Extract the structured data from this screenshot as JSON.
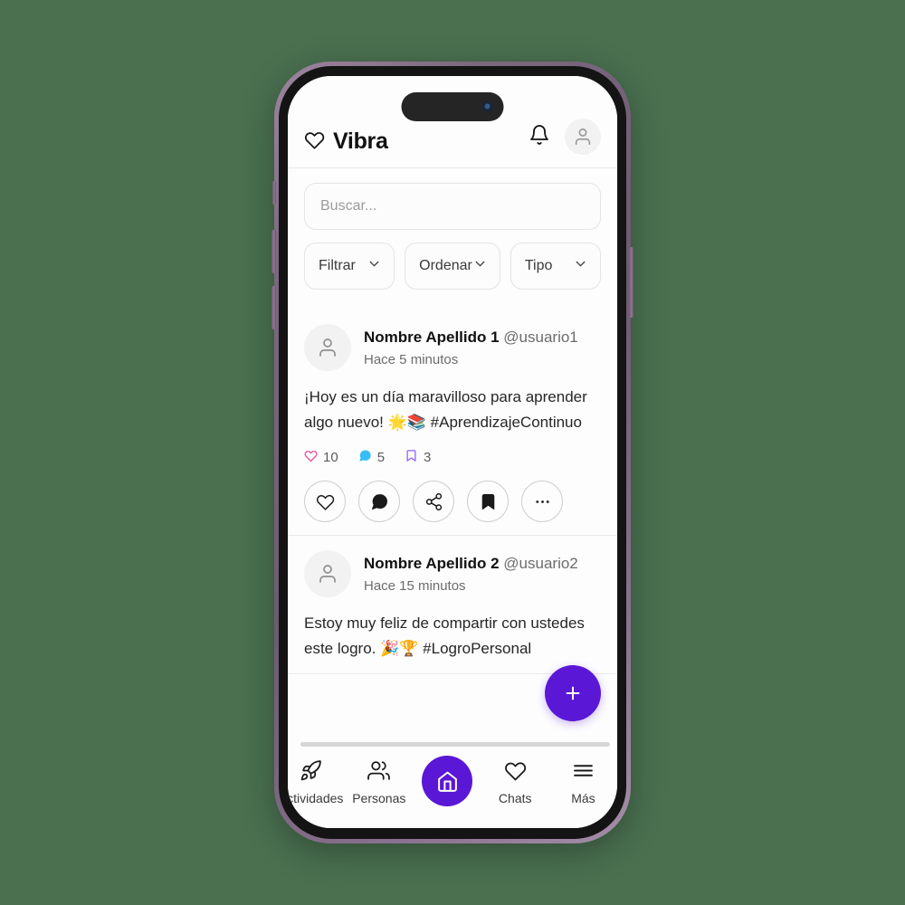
{
  "app": {
    "brand_name": "Vibra",
    "brand_icon": "heart-outline-icon",
    "notifications_icon": "bell-icon",
    "profile_icon": "user-avatar-icon"
  },
  "search": {
    "placeholder": "Buscar...",
    "value": ""
  },
  "filters": [
    {
      "label": "Filtrar",
      "icon": "chevron-down-icon"
    },
    {
      "label": "Ordenar",
      "icon": "chevron-down-icon"
    },
    {
      "label": "Tipo",
      "icon": "chevron-down-icon"
    }
  ],
  "posts": [
    {
      "author": "Nombre Apellido 1",
      "handle": "@usuario1",
      "time": "Hace 5 minutos",
      "body": "¡Hoy es un día maravilloso para aprender algo nuevo! 🌟📚 #AprendizajeContinuo",
      "stats": {
        "likes": "10",
        "comments": "5",
        "bookmarks": "3"
      }
    },
    {
      "author": "Nombre Apellido 2",
      "handle": "@usuario2",
      "time": "Hace 15 minutos",
      "body": "Estoy muy feliz de compartir con ustedes este logro. 🎉🏆 #LogroPersonal",
      "stats": {
        "likes": "",
        "comments": "",
        "bookmarks": ""
      }
    }
  ],
  "post_actions": [
    {
      "name": "like",
      "icon": "heart-icon"
    },
    {
      "name": "comment",
      "icon": "comment-icon"
    },
    {
      "name": "share",
      "icon": "share-icon"
    },
    {
      "name": "bookmark",
      "icon": "bookmark-icon"
    },
    {
      "name": "more",
      "icon": "ellipsis-icon"
    }
  ],
  "fab": {
    "label": "+",
    "icon": "plus-icon"
  },
  "bottom_nav": [
    {
      "label": "Actividades",
      "icon": "rocket-icon",
      "active": false
    },
    {
      "label": "Personas",
      "icon": "people-icon",
      "active": false
    },
    {
      "label": "",
      "icon": "home-icon",
      "active": true
    },
    {
      "label": "Chats",
      "icon": "heart-icon",
      "active": false
    },
    {
      "label": "Más",
      "icon": "hamburger-icon",
      "active": false
    }
  ],
  "colors": {
    "accent_purple": "#5a17d6",
    "like_pink": "#ec4899",
    "comment_blue": "#38bdf8",
    "bookmark_purple": "#8b5cf6",
    "page_background": "#4a7050",
    "screen_background": "#fdfdfd"
  }
}
